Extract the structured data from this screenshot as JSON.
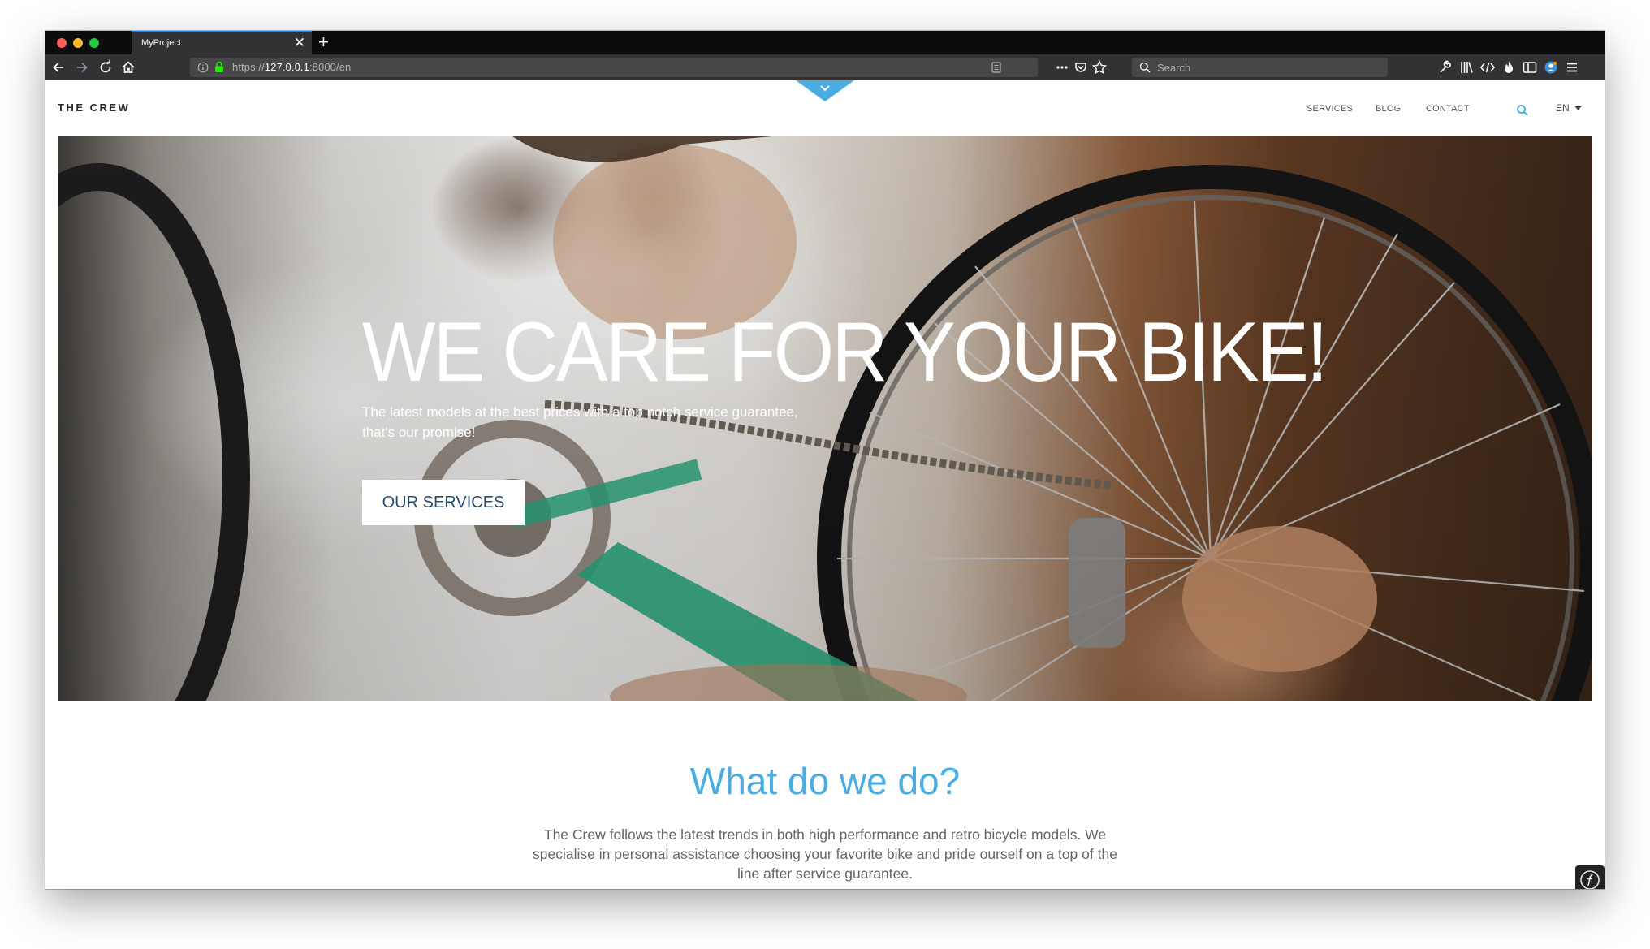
{
  "browser": {
    "tab_title": "MyProject",
    "tab_close": "✕",
    "new_tab": "+",
    "url_scheme": "https://",
    "url_host": "127.0.0.1",
    "url_rest": ":8000/en",
    "search_placeholder": "Search"
  },
  "site": {
    "logo": "THE CREW",
    "nav": {
      "services": "SERVICES",
      "blog": "BLOG",
      "contact": "CONTACT",
      "language": "EN"
    },
    "hero": {
      "title": "WE CARE FOR YOUR BIKE!",
      "subtitle": "The latest models at the best prices with a top notch service guarantee, that's our promise!",
      "button": "OUR SERVICES"
    },
    "section": {
      "title": "What do we do?",
      "text": "The Crew follows the latest trends in both high performance and retro bicycle models. We specialise in personal assistance choosing your favorite bike and pride ourself on a top of the line after service guarantee."
    }
  },
  "colors": {
    "accent": "#4aace0",
    "button_text": "#2a4b6b",
    "browser_chrome": "#323234"
  },
  "icons": [
    "back-icon",
    "forward-icon",
    "reload-icon",
    "home-icon",
    "info-icon",
    "lock-icon",
    "reader-mode-icon",
    "more-icon",
    "pocket-icon",
    "star-icon",
    "search-icon",
    "wrench-icon",
    "library-icon",
    "devtools-icon",
    "fire-icon",
    "sidebar-icon",
    "account-icon",
    "menu-icon",
    "chevron-down-icon",
    "symfony-icon"
  ]
}
